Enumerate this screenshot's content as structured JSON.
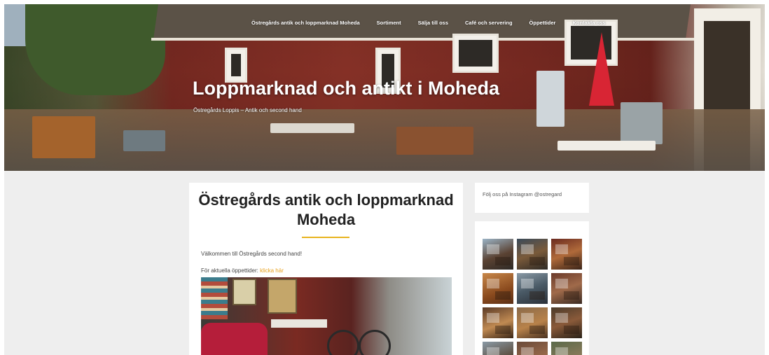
{
  "nav": {
    "items": [
      "Östregårds antik och loppmarknad Moheda",
      "Sortiment",
      "Sälja till oss",
      "Café och servering",
      "Öppettider",
      "Kontakta oss"
    ]
  },
  "hero": {
    "title": "Loppmarknad och antikt i Moheda",
    "subtitle": "Östregårds Loppis – Antik och second hand"
  },
  "main": {
    "title": "Östregårds antik och loppmarknad Moheda",
    "welcome": "Välkommen till Östregårds second hand!",
    "hours_prefix": "För aktuella öppettider:",
    "hours_link": "klicka här"
  },
  "sidebar": {
    "instagram_text": "Följ oss på Instagram @ostregard"
  },
  "colors": {
    "accent": "#e8b31e",
    "link": "#e8a21e",
    "background": "#eeeeee"
  }
}
